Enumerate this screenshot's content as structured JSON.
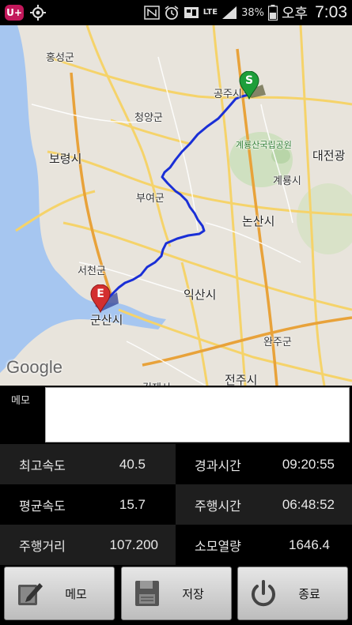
{
  "status_bar": {
    "app_badge": "U+",
    "lte": "LTE",
    "battery": "38%",
    "ampm": "오후",
    "time": "7:03"
  },
  "map": {
    "labels": {
      "hongseong": "홍성군",
      "gongju": "공주시",
      "cheongyang": "청양군",
      "gyeryongsan": "계룡산국립공원",
      "daejeon": "대전광",
      "boryeong": "보령시",
      "gyeryong": "계룡시",
      "buyeo": "부여군",
      "nonsan": "논산시",
      "seocheon": "서천군",
      "iksan": "익산시",
      "gunsan": "군산시",
      "wanju": "완주군",
      "jeonju": "전주시",
      "gimje": "김제시"
    },
    "start_marker": "S",
    "end_marker": "E",
    "attribution": "Google"
  },
  "memo": {
    "label": "메모",
    "value": ""
  },
  "stats": [
    {
      "label": "최고속도",
      "value": "40.5"
    },
    {
      "label": "경과시간",
      "value": "09:20:55"
    },
    {
      "label": "평균속도",
      "value": "15.7"
    },
    {
      "label": "주행시간",
      "value": "06:48:52"
    },
    {
      "label": "주행거리",
      "value": "107.200"
    },
    {
      "label": "소모열량",
      "value": "1646.4"
    }
  ],
  "buttons": {
    "memo": "메모",
    "save": "저장",
    "end": "종료"
  },
  "colors": {
    "route": "#1a2fd6",
    "start_marker": "#1e9e3a",
    "end_marker": "#d32f2f"
  }
}
